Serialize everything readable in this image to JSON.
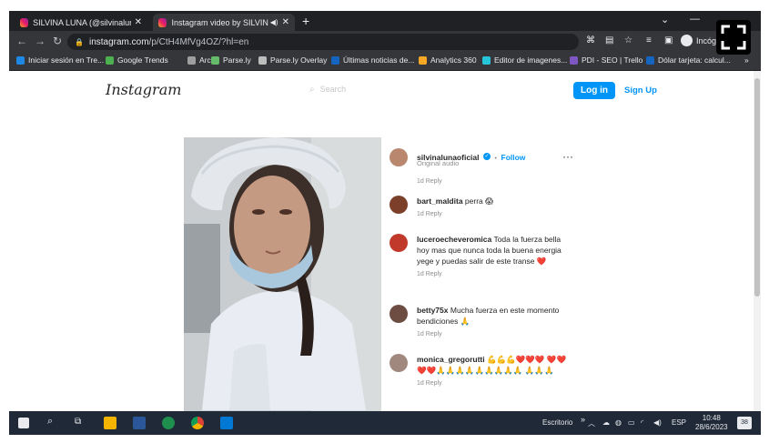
{
  "browser": {
    "tabs": [
      {
        "title": "SILVINA LUNA (@silvinalunaofici",
        "active": false
      },
      {
        "title": "Instagram video by SILVINA",
        "active": true
      }
    ],
    "new_tab_label": "+",
    "url_domain": "instagram.com",
    "url_path": "/p/CtH4MfVg4OZ/?hl=en",
    "profile_label": "Incógn",
    "bookmarks": [
      {
        "label": "Iniciar sesión en Tre...",
        "color": "#1e88e5"
      },
      {
        "label": "Google Trends",
        "color": "#4caf50"
      },
      {
        "label": "Arc",
        "color": "#9e9e9e"
      },
      {
        "label": "Parse.ly",
        "color": "#66bb6a"
      },
      {
        "label": "Parse.ly Overlay",
        "color": "#bdbdbd"
      },
      {
        "label": "Últimas noticias de...",
        "color": "#1565c0"
      },
      {
        "label": "Analytics 360",
        "color": "#f9a825"
      },
      {
        "label": "Editor de imagenes...",
        "color": "#26c6da"
      },
      {
        "label": "PDI - SEO | Trello",
        "color": "#7e57c2"
      },
      {
        "label": "Dólar tarjeta: calcul...",
        "color": "#1565c0"
      }
    ],
    "bookmarks_more": "»"
  },
  "instagram": {
    "logo": "Instagram",
    "search_placeholder": "Search",
    "login_label": "Log in",
    "signup_label": "Sign Up",
    "post": {
      "username": "silvinalunaoficial",
      "follow_label": "Follow",
      "sub": "Original audio",
      "meta": "1d  Reply",
      "comments": [
        {
          "user": "bart_maldita",
          "text": "perra 😱",
          "meta": "1d  Reply",
          "avatar_color": "#7b3f2a"
        },
        {
          "user": "luceroecheveromica",
          "text": "Toda la fuerza bella hoy mas que nunca toda la buena energia yege y puedas salir de este transe ❤️",
          "meta": "1d  Reply",
          "avatar_color": "#c0392b"
        },
        {
          "user": "betty75x",
          "text": "Mucha fuerza en este momento bendiciones 🙏",
          "meta": "1d  Reply",
          "avatar_color": "#6d4c41"
        },
        {
          "user": "monica_gregorutti",
          "text": "💪💪💪❤️❤️❤️ ❤️❤️❤️❤️🙏🙏🙏🙏🙏🙏🙏🙏🙏 🙏🙏🙏",
          "meta": "1d  Reply",
          "avatar_color": "#a1887f"
        }
      ]
    }
  },
  "taskbar": {
    "desktop_label": "Escritorio",
    "language": "ESP",
    "time": "10:48",
    "date": "28/6/2023",
    "notifications": "38"
  }
}
